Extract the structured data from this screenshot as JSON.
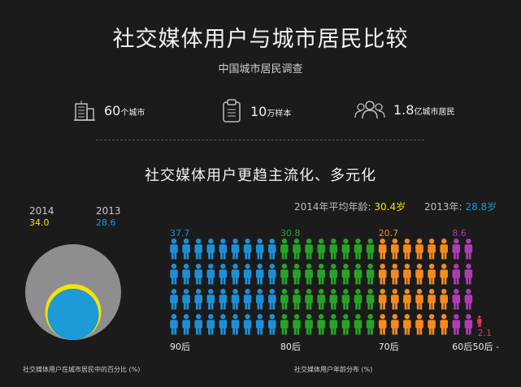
{
  "header": {
    "title": "社交媒体用户与城市居民比较",
    "subtitle": "中国城市居民调查"
  },
  "stats": [
    {
      "icon": "buildings-icon",
      "value": "60",
      "unit": "个城市"
    },
    {
      "icon": "clipboard-icon",
      "value": "10",
      "unit": "万样本"
    },
    {
      "icon": "people-group-icon",
      "value": "1.8",
      "unit": "亿城市居民"
    }
  ],
  "headline": "社交媒体用户更趋主流化、多元化",
  "colors": {
    "c2014": "#f4e400",
    "c2013": "#1e9ad6",
    "circle_bg": "#8e8e90",
    "90后": "#1e8fd6",
    "80后": "#27a327",
    "70后": "#f58a1f",
    "60后": "#b23ab4",
    "50后": "#e8345a"
  },
  "chart_data": [
    {
      "type": "bubble",
      "caption": "社交媒体用户在城市居民中的百分比 (%)",
      "series": [
        {
          "name": "2014",
          "value": 34.0,
          "label": "34.0"
        },
        {
          "name": "2013",
          "value": 28.6,
          "label": "28.6"
        }
      ],
      "total": 100
    },
    {
      "type": "pictogram",
      "caption": "社交媒体用户年龄分布 (%)",
      "avg": {
        "label_2014": "2014年平均年龄: ",
        "value_2014": "30.4岁",
        "label_2013": "2013年: ",
        "value_2013": "28.8岁"
      },
      "categories": [
        "90后",
        "80后",
        "70后",
        "60后",
        "50后 -"
      ],
      "values": [
        37.7,
        30.8,
        20.7,
        8.6,
        2.1
      ],
      "value_labels": [
        "37.7",
        "30.8",
        "20.7",
        "8.6",
        "2.1"
      ]
    }
  ]
}
